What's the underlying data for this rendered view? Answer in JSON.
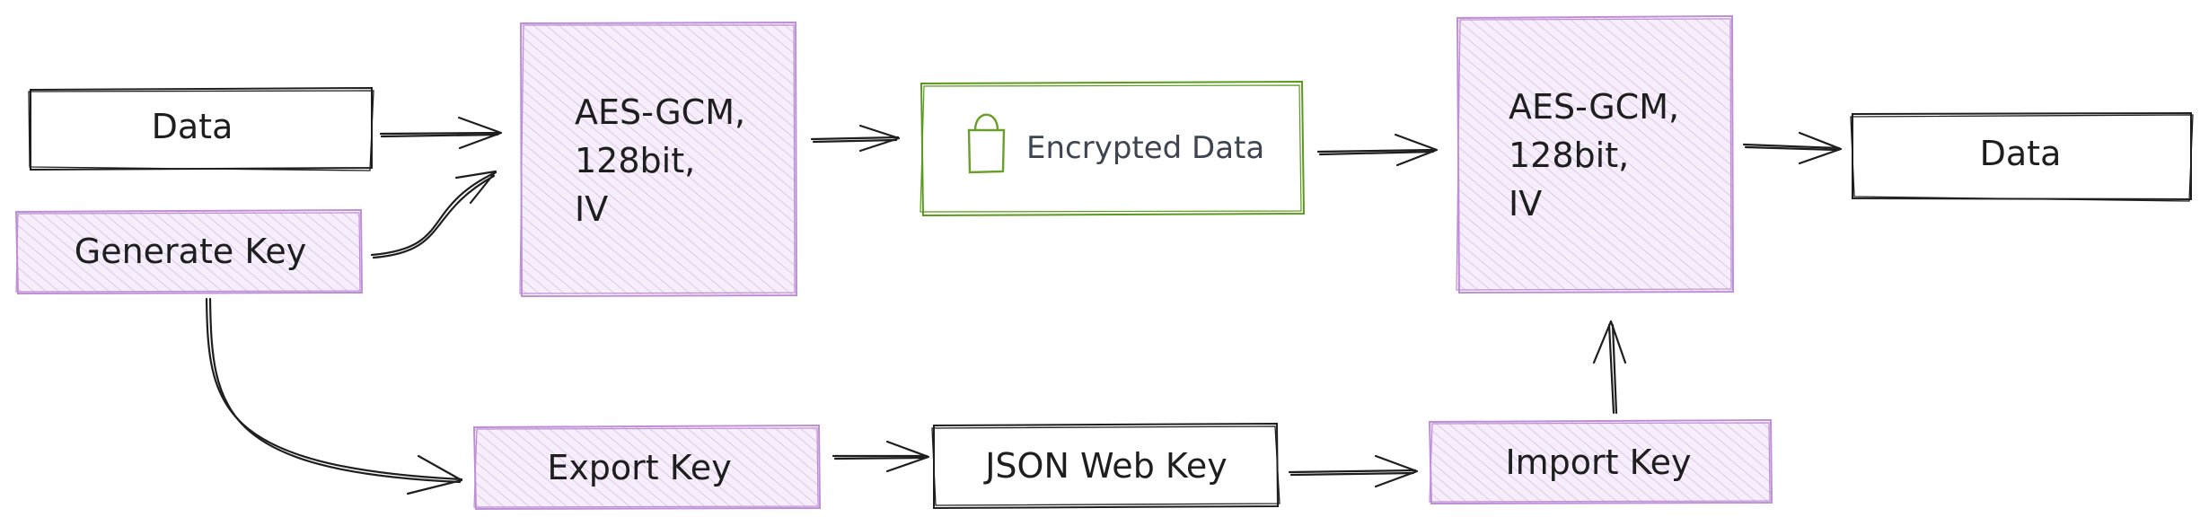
{
  "nodes": {
    "data_in": "Data",
    "generate_key": "Generate Key",
    "encrypt": {
      "line1": "AES-GCM,",
      "line2": "128bit,",
      "line3": "IV"
    },
    "encrypted_data": "Encrypted Data",
    "decrypt": {
      "line1": "AES-GCM,",
      "line2": "128bit,",
      "line3": "IV"
    },
    "data_out": "Data",
    "export_key": "Export Key",
    "json_web_key": "JSON Web Key",
    "import_key": "Import Key"
  },
  "colors": {
    "stroke": "#1e1e1e",
    "purple_stroke": "#be8fd6",
    "purple_fill": "#ead7f2",
    "green_stroke": "#5a9a1e",
    "green_lock": "#6a9f2a",
    "hatch": "#d7b8e6"
  }
}
